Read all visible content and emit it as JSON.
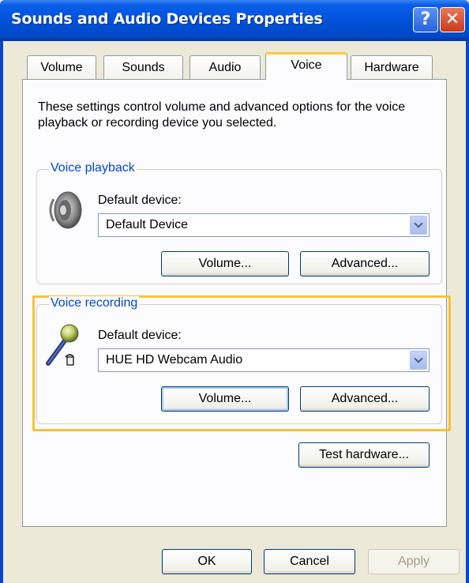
{
  "window": {
    "title": "Sounds and Audio Devices Properties",
    "help_glyph": "?",
    "close_glyph": "✕"
  },
  "tabs": [
    {
      "label": "Volume",
      "active": false
    },
    {
      "label": "Sounds",
      "active": false
    },
    {
      "label": "Audio",
      "active": false
    },
    {
      "label": "Voice",
      "active": true
    },
    {
      "label": "Hardware",
      "active": false
    }
  ],
  "description": "These settings control volume and advanced options for the voice playback or recording device you selected.",
  "voice_playback": {
    "group_label": "Voice playback",
    "icon": "speaker-icon",
    "device_label": "Default device:",
    "device_value": "Default Device",
    "volume_button": "Volume...",
    "advanced_button": "Advanced..."
  },
  "voice_recording": {
    "group_label": "Voice recording",
    "icon": "microphone-icon",
    "device_label": "Default device:",
    "device_value": "HUE HD Webcam Audio",
    "volume_button": "Volume...",
    "advanced_button": "Advanced..."
  },
  "test_hardware_button": "Test hardware...",
  "footer": {
    "ok": "OK",
    "cancel": "Cancel",
    "apply": "Apply"
  },
  "colors": {
    "titlebar": "#0051d8",
    "highlight": "#f5c23a",
    "group_label": "#0046d5"
  }
}
